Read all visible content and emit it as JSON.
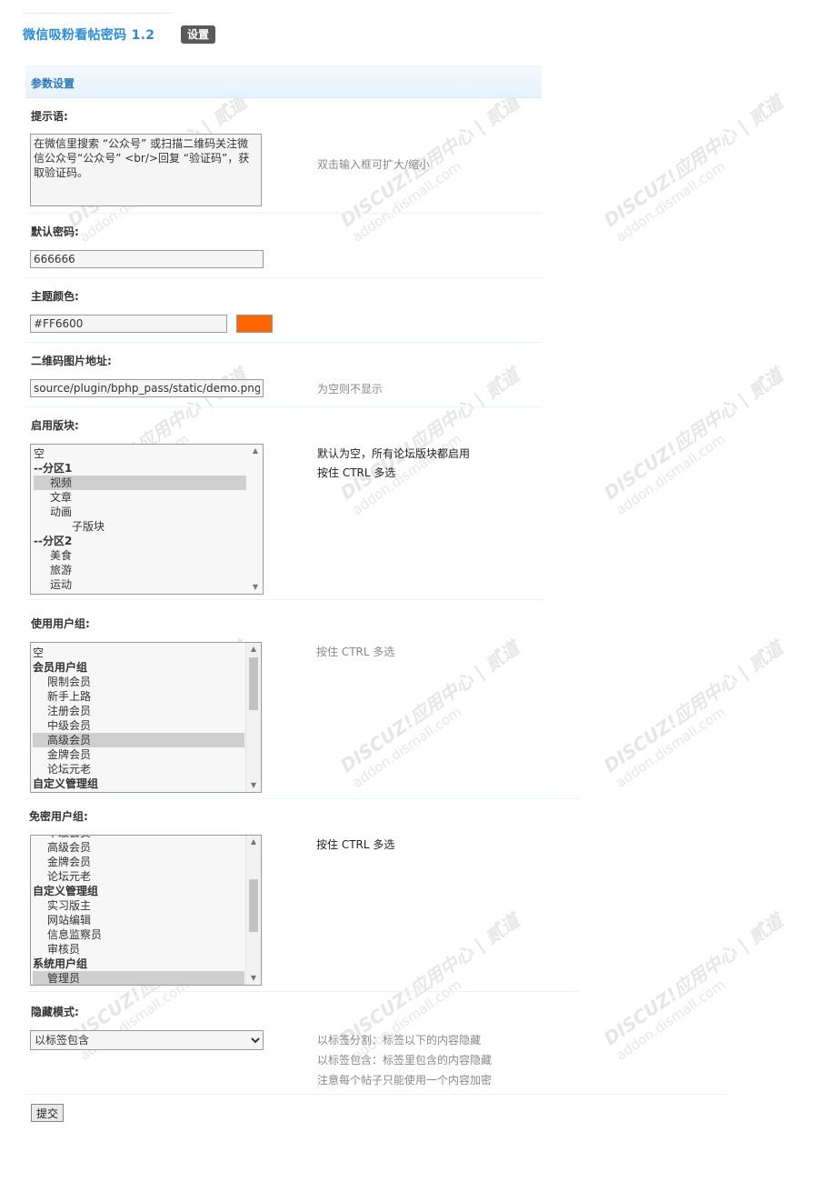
{
  "header": {
    "title": "微信吸粉看帖密码 1.2",
    "settings_button": "设置"
  },
  "section": {
    "title": "参数设置"
  },
  "fields": {
    "prompt": {
      "label": "提示语:",
      "value": "在微信里搜索 “公众号” 或扫描二维码关注微信公众号“公众号” <br/>回复 “验证码”，获取验证码。",
      "hint": "双击输入框可扩大/缩小"
    },
    "default_password": {
      "label": "默认密码:",
      "value": "666666"
    },
    "theme_color": {
      "label": "主题颜色:",
      "value": "#FF6600",
      "swatch_color": "#FF6600"
    },
    "qrcode_url": {
      "label": "二维码图片地址:",
      "value": "source/plugin/bphp_pass/static/demo.png",
      "hint": "为空则不显示"
    },
    "enabled_forums": {
      "label": "启用版块:",
      "hint_lines": [
        "默认为空，所有论坛版块都启用",
        "按住 CTRL 多选"
      ],
      "options": [
        {
          "text": "空",
          "group": false,
          "selected": false,
          "indent": 0
        },
        {
          "text": "--分区1",
          "group": true,
          "selected": false,
          "indent": 0
        },
        {
          "text": "视频",
          "group": false,
          "selected": true,
          "indent": 1
        },
        {
          "text": "文章",
          "group": false,
          "selected": false,
          "indent": 1
        },
        {
          "text": "动画",
          "group": false,
          "selected": false,
          "indent": 1
        },
        {
          "text": "子版块",
          "group": false,
          "selected": false,
          "indent": 2
        },
        {
          "text": "--分区2",
          "group": true,
          "selected": false,
          "indent": 0
        },
        {
          "text": "美食",
          "group": false,
          "selected": false,
          "indent": 1
        },
        {
          "text": "旅游",
          "group": false,
          "selected": false,
          "indent": 1
        },
        {
          "text": "运动",
          "group": false,
          "selected": false,
          "indent": 1
        }
      ]
    },
    "user_groups": {
      "label": "使用用户组:",
      "hint": "按住 CTRL 多选",
      "options": [
        {
          "text": "空",
          "group": false,
          "selected": false
        },
        {
          "text": "会员用户组",
          "group": true,
          "selected": false
        },
        {
          "text": "限制会员",
          "group": false,
          "selected": false
        },
        {
          "text": "新手上路",
          "group": false,
          "selected": false
        },
        {
          "text": "注册会员",
          "group": false,
          "selected": false
        },
        {
          "text": "中级会员",
          "group": false,
          "selected": false
        },
        {
          "text": "高级会员",
          "group": false,
          "selected": true
        },
        {
          "text": "金牌会员",
          "group": false,
          "selected": false
        },
        {
          "text": "论坛元老",
          "group": false,
          "selected": false
        },
        {
          "text": "自定义管理组",
          "group": true,
          "selected": false
        }
      ]
    },
    "exempt_groups": {
      "label": "免密用户组:",
      "hint": "按住 CTRL 多选",
      "options": [
        {
          "text": "中级会员",
          "group": false,
          "selected": false
        },
        {
          "text": "高级会员",
          "group": false,
          "selected": false
        },
        {
          "text": "金牌会员",
          "group": false,
          "selected": false
        },
        {
          "text": "论坛元老",
          "group": false,
          "selected": false
        },
        {
          "text": "自定义管理组",
          "group": true,
          "selected": false
        },
        {
          "text": "实习版主",
          "group": false,
          "selected": false
        },
        {
          "text": "网站编辑",
          "group": false,
          "selected": false
        },
        {
          "text": "信息监察员",
          "group": false,
          "selected": false
        },
        {
          "text": "审核员",
          "group": false,
          "selected": false
        },
        {
          "text": "系统用户组",
          "group": true,
          "selected": false
        },
        {
          "text": "管理员",
          "group": false,
          "selected": true
        }
      ]
    },
    "hide_mode": {
      "label": "隐藏模式:",
      "selected": "以标签包含",
      "options": [
        "以标签分割",
        "以标签包含"
      ],
      "hint_lines": [
        "以标签分割：标签以下的内容隐藏",
        "以标签包含：标签里包含的内容隐藏",
        "注意每个帖子只能使用一个内容加密"
      ]
    }
  },
  "submit_label": "提交",
  "watermark": {
    "brand": "DISCUZ!应用中心 | 贰道",
    "domain": "addon.dismall.com"
  }
}
